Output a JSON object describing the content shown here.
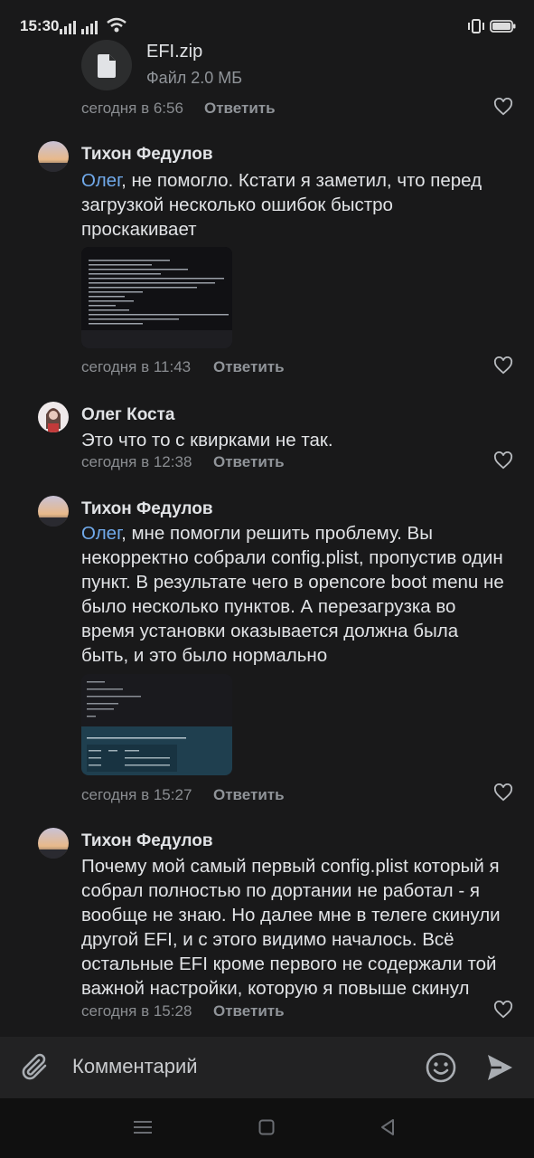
{
  "status_bar": {
    "time": "15:30"
  },
  "file": {
    "name": "EFI.zip",
    "size": "Файл 2.0 МБ",
    "time": "сегодня в 6:56",
    "reply": "Ответить"
  },
  "comments": [
    {
      "author": "Тихон Федулов",
      "mention": "Олег",
      "text": ", не помогло. Кстати я заметил, что перед загрузкой несколько ошибок быстро проскакивает",
      "time": "сегодня в 11:43",
      "reply": "Ответить"
    },
    {
      "author": "Олег Коста",
      "text": "Это что то с квирками не так.",
      "time": "сегодня в 12:38",
      "reply": "Ответить"
    },
    {
      "author": "Тихон Федулов",
      "mention": "Олег",
      "text": ", мне помогли решить проблему. Вы некорректно собрали config.plist, пропустив один пункт. В результате чего в opencore boot menu не было несколько пунктов. А перезагрузка во время установки оказывается должна была быть, и это было нормально",
      "time": "сегодня в 15:27",
      "reply": "Ответить"
    },
    {
      "author": "Тихон Федулов",
      "text": "Почему мой самый первый config.plist который я собрал полностью по дортании не работал - я вообще не знаю. Но далее мне в телеге скинули другой EFI, и с этого видимо началось. Всё остальные EFI кроме первого не содержали той важной настройки, которую я повыше скинул",
      "time": "сегодня в 15:28",
      "reply": "Ответить"
    }
  ],
  "composer": {
    "placeholder": "Комментарий"
  },
  "colors": {
    "background": "#19191a",
    "mention": "#71aaeb",
    "muted": "#909499"
  },
  "icons": [
    "attach-icon",
    "emoji-icon",
    "send-icon",
    "heart-icon",
    "file-icon"
  ]
}
